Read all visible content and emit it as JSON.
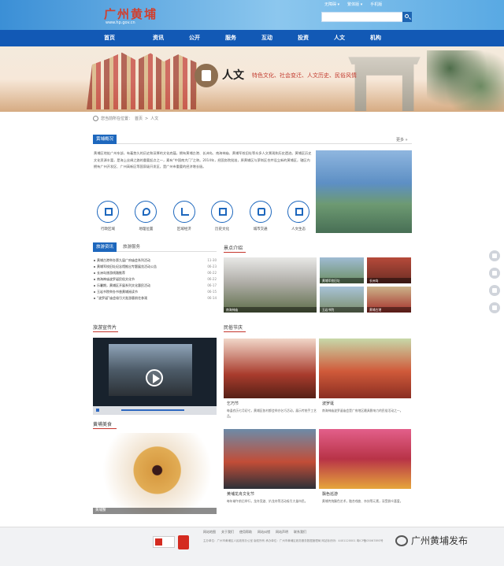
{
  "header": {
    "logo": "广州黄埔",
    "domain": "www.hp.gov.cn",
    "top_links": [
      "无障碍 ▾",
      "繁体版 ▾",
      "手机版"
    ]
  },
  "nav": [
    "首页",
    "资讯",
    "公开",
    "服务",
    "互动",
    "投资",
    "人文",
    "机构"
  ],
  "banner": {
    "title": "人文",
    "subtitle": "特色文化、社会变迁、人文历史、民俗风情"
  },
  "breadcrumb": {
    "prefix": "您当前所在位置：",
    "home": "首页",
    "current": "人文"
  },
  "overview": {
    "tab": "黄埔概况",
    "more": "更多 »",
    "text": "黄埔区地处广州东部，有着悠久的历史和深厚的文化底蕴，拥有黄埔古港、长洲岛、南海神庙、黄埔军校旧址等众多人文景观和历史遗迹。黄埔区历史文化资源丰富，是海上丝绸之路的重要起点之一，素有“中国南大门”之称。2014年，经国务院批准，原黄埔区与萝岗区合并设立新的黄埔区，辖区内拥有广州开发区、广州高新区等国家级开发区，是广州市重要的经济增长极。"
  },
  "icons": [
    "行政区域",
    "地理位置",
    "区域经济",
    "历史文化",
    "城市交通",
    "人文生态"
  ],
  "news": {
    "tabs": [
      "旅游资讯",
      "旅游服务"
    ],
    "items": [
      {
        "title": "黄埔古港举办第九届广府庙会系列活动",
        "date": "11-30"
      },
      {
        "title": "黄埔军校旧址纪念馆推出专题展览活动公告",
        "date": "06-23"
      },
      {
        "title": "长洲岛旅游线路推荐",
        "date": "06-22"
      },
      {
        "title": "南海神庙波罗诞民俗文化节",
        "date": "06-22"
      },
      {
        "title": "乐暑期，黄埔区开展系列文化惠民活动",
        "date": "06-17"
      },
      {
        "title": "玉岩书院举办书香黄埔阅读节",
        "date": "06-15"
      },
      {
        "title": "“波罗诞”庙会吸引大批游客前往参观",
        "date": "06-14"
      }
    ]
  },
  "scenery": {
    "header": "景点介绍",
    "items": [
      "南海神庙",
      "黄埔军校旧址",
      "长洲岛",
      "玉岩书院",
      "黄埔古港",
      "丹水坑风景区"
    ]
  },
  "video": {
    "header": "旅游宣传片"
  },
  "folk": {
    "header": "民俗节庆",
    "items": [
      {
        "title": "乞巧节",
        "text": "每逢农历七月初七，黄埔区各村都会举办乞巧活动，展示传统手工艺品。"
      },
      {
        "title": "波罗诞",
        "text": "南海神庙波罗诞庙会是广府地区最具影响力的民俗活动之一。"
      },
      {
        "title": "黄埔龙舟文化节",
        "text": "每年端午前后举行，龙舟竞渡、扒龙舟等活动吸引大量市民。"
      },
      {
        "title": "飘色巡游",
        "text": "黄埔传统飘色艺术，融合戏曲、杂技等元素，深受群众喜爱。"
      }
    ]
  },
  "food": {
    "header": "黄埔美食",
    "caption": "黄埔蟹"
  },
  "footer": {
    "links": [
      "网站地图",
      "关于我们",
      "使用帮助",
      "网站纠错",
      "网站声明",
      "联系我们"
    ],
    "text": "主办单位：广州市黄埔区人民政府办公室 版权所有 承办单位：广州市黄埔区政务服务数据管理局 网站标识码：4401120001 粤ICP备05067893号"
  },
  "watermark": "广州黄埔发布"
}
